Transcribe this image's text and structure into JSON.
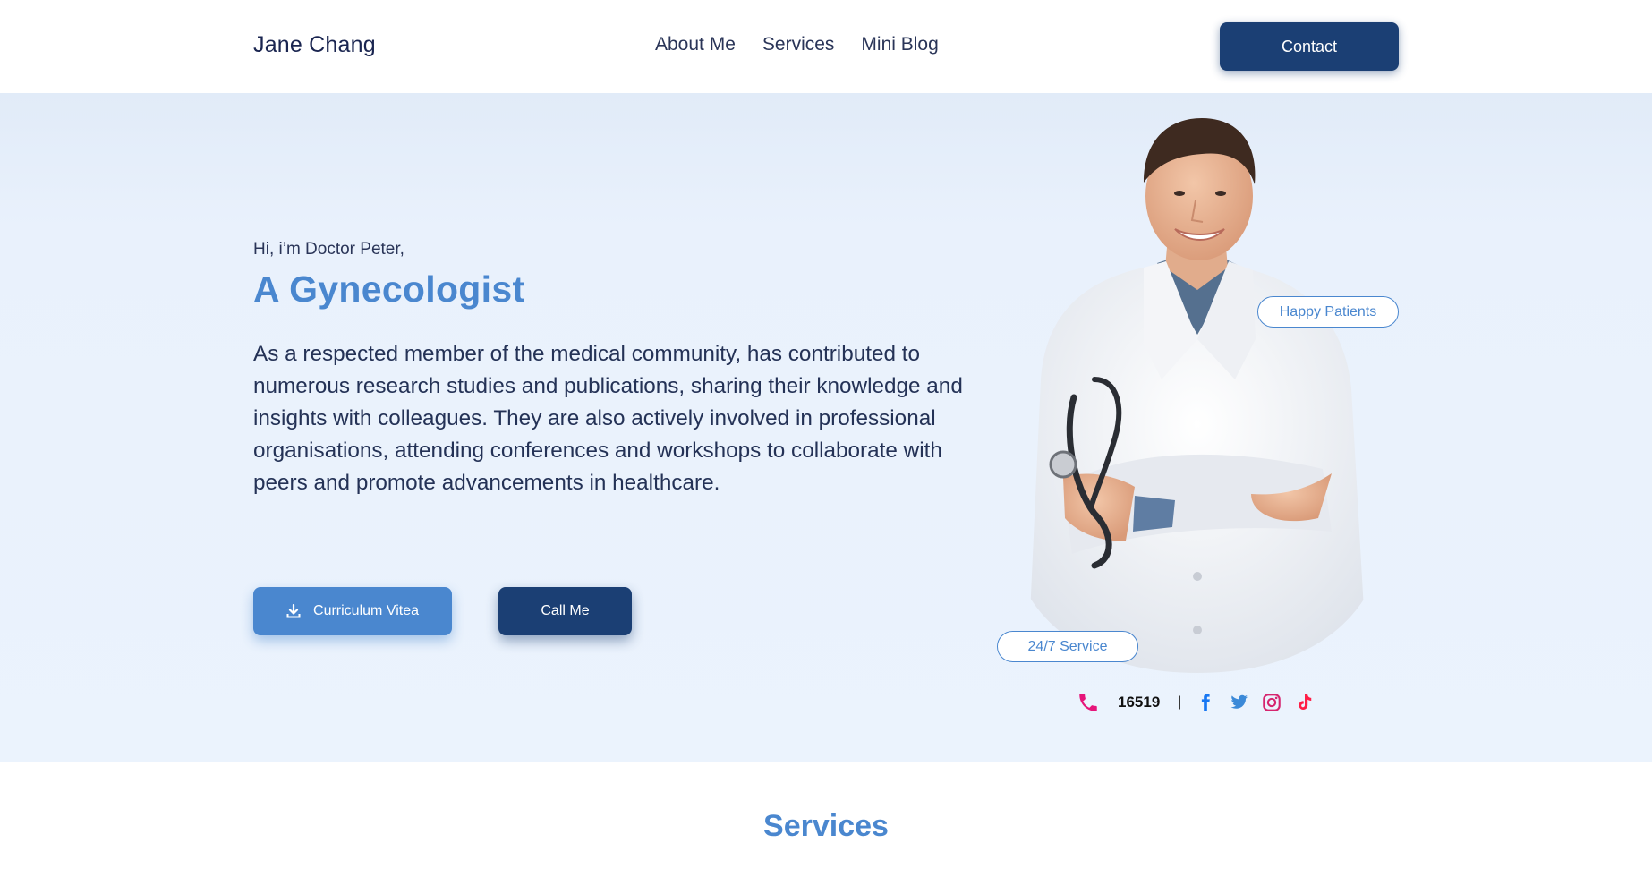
{
  "header": {
    "brand": "Jane Chang",
    "nav": [
      "About Me",
      "Services",
      "Mini Blog"
    ],
    "contact_label": "Contact"
  },
  "hero": {
    "greeting": "Hi, i’m Doctor Peter,",
    "role": "A Gynecologist",
    "description": "As a respected member of the medical community, has contributed to numerous research studies and publications, sharing their knowledge and insights with colleagues. They are also actively involved in professional organisations, attending conferences and workshops to collaborate with peers and promote advancements in healthcare.",
    "cv_label": "Curriculum Vitea",
    "call_label": "Call Me",
    "badges": {
      "patients": "Happy Patients",
      "service": "24/7 Service"
    },
    "contact": {
      "phone": "16519",
      "separator": "|",
      "socials": [
        "facebook-icon",
        "twitter-icon",
        "instagram-icon",
        "tiktok-icon"
      ]
    }
  },
  "services": {
    "title": "Services"
  },
  "colors": {
    "accent": "#4a87cf",
    "navy": "#1b3f74",
    "hero_bg": "#ebf3fd",
    "phone_pink": "#e6157a",
    "facebook": "#1877f2",
    "twitter": "#3b89d8",
    "instagram": "#d6246e",
    "tiktok": "#ff1e46"
  }
}
